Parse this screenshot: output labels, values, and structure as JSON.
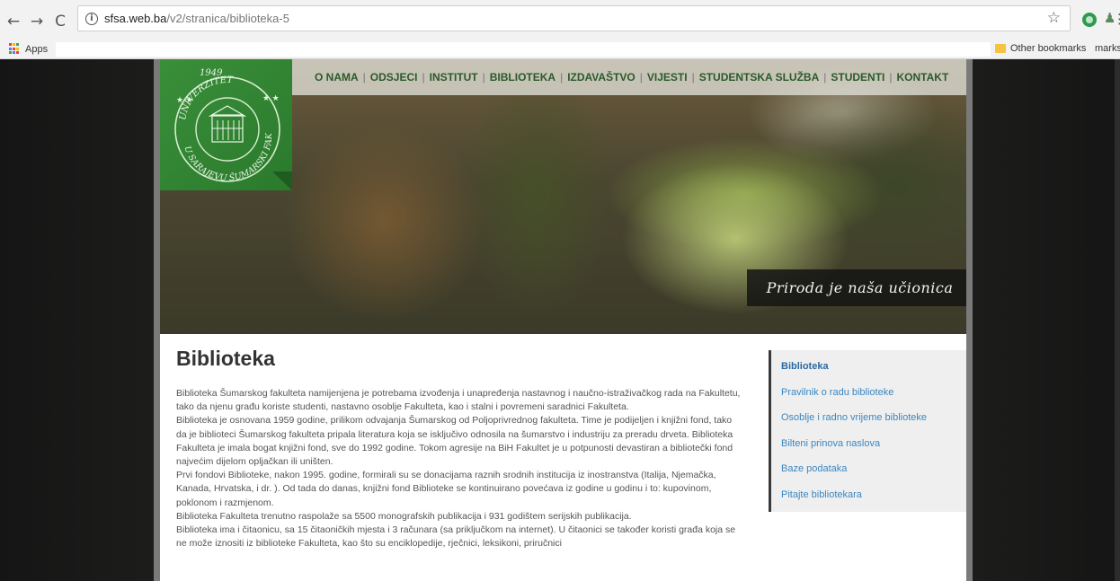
{
  "browser": {
    "url_domain": "sfsa.web.ba",
    "url_path": "/v2/stranica/biblioteka-5",
    "bookmarks_apps": "Apps",
    "bookmarks_other": "Other bookmarks",
    "bookmarks_overflow": "marks",
    "apps_icon_colors": [
      "#ea4335",
      "#fbbc05",
      "#34a853",
      "#4285f4",
      "#ea4335",
      "#fbbc05",
      "#34a853",
      "#4285f4",
      "#ea4335"
    ]
  },
  "nav": {
    "items": [
      "O NAMA",
      "ODSJECI",
      "INSTITUT",
      "BIBLIOTEKA",
      "IZDAVAŠTVO",
      "VIJESTI",
      "STUDENTSKA SLUŽBA",
      "STUDENTI",
      "KONTAKT"
    ],
    "separator": "|"
  },
  "logo": {
    "year": "1949",
    "top_text": "UNIVERZITET",
    "mid_text": "U SARAJEVU",
    "bottom_text": "ŠUMARSKI FAKULTET",
    "color": "#2e8b2e"
  },
  "banner": {
    "slogan": "Priroda je naša učionica"
  },
  "page": {
    "title": "Biblioteka",
    "paragraphs": [
      "Biblioteka Šumarskog fakulteta namijenjena je potrebama izvođenja i unapređenja nastavnog i naučno-istraživačkog rada na Fakultetu, tako da njenu građu koriste studenti, nastavno osoblje  Fakulteta, kao i stalni i povremeni saradnici Fakulteta.",
      "Biblioteka je osnovana 1959 godine, prilikom odvajanja Šumarskog od Poljoprivrednog fakulteta. Time je podijeljen i knjižni fond, tako da je biblioteci Šumarskog fakulteta pripala literatura koja se isključivo odnosila na šumarstvo i industriju za preradu drveta. Biblioteka Fakulteta je imala bogat knjižni fond, sve do 1992 godine. Tokom agresije na BiH Fakultet je u potpunosti devastiran a bibliotečki fond najvećim dijelom opljačkan ili uništen.",
      "Prvi fondovi  Biblioteke, nakon 1995. godine, formirali su se donacijama raznih srodnih institucija iz inostranstva (Italija, Njemačka, Kanada, Hrvatska,  i dr. ). Od tada do danas, knjižni fond Biblioteke se kontinuirano povećava iz godine u godinu i to: kupovinom, poklonom i razmjenom.",
      "Biblioteka Fakulteta trenutno raspolaže sa 5500 monografskih publikacija i 931 godištem serijskih publikacija.",
      "Biblioteka ima i čitaonicu, sa 15 čitaoničkih mjesta i 3 računara (sa priključkom na internet). U čitaonici se također koristi građa koja se ne može iznositi iz biblioteke Fakulteta, kao što su enciklopedije, rječnici, leksikoni, priručnici"
    ]
  },
  "sidebar": {
    "items": [
      {
        "label": "Biblioteka",
        "active": true
      },
      {
        "label": "Pravilnik o radu biblioteke",
        "active": false
      },
      {
        "label": "Osoblje i radno vrijeme biblioteke",
        "active": false
      },
      {
        "label": "Bilteni prinova naslova",
        "active": false
      },
      {
        "label": "Baze podataka",
        "active": false
      },
      {
        "label": "Pitajte bibliotekara",
        "active": false
      }
    ]
  }
}
